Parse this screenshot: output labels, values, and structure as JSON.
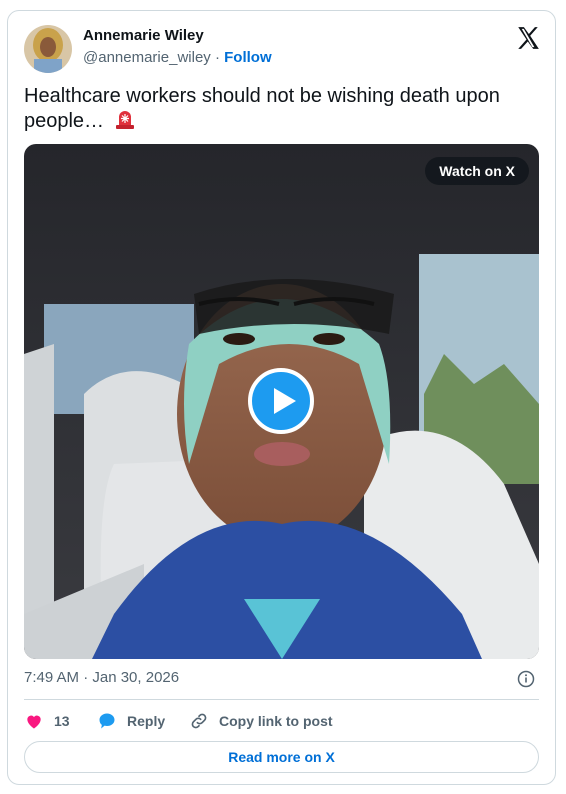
{
  "author": {
    "name": "Annemarie Wiley",
    "handle": "@annemarie_wiley",
    "separator": "·",
    "follow_label": "Follow"
  },
  "tweet": {
    "text": "Healthcare workers should not be wishing death upon people…",
    "emoji": "police-light-emoji"
  },
  "video": {
    "watch_label": "Watch on X"
  },
  "meta": {
    "timestamp": "7:49 AM · Jan 30, 2026"
  },
  "actions": {
    "like_count": "13",
    "reply_label": "Reply",
    "copy_label": "Copy link to post"
  },
  "footer": {
    "read_more_label": "Read more on X"
  },
  "colors": {
    "accent": "#006fd6",
    "like": "#f91880",
    "reply": "#1d9bf0",
    "muted": "#536471",
    "border": "#cfd9de"
  }
}
